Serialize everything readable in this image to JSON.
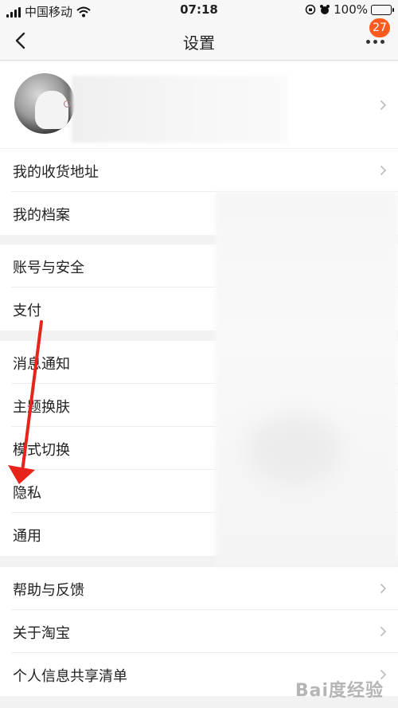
{
  "status_bar": {
    "carrier": "中国移动",
    "time": "07:18",
    "battery": "100%"
  },
  "nav": {
    "title": "设置",
    "notification_count": "27"
  },
  "sections": [
    {
      "items": [
        {
          "label": "我的收货地址"
        },
        {
          "label": "我的档案"
        }
      ]
    },
    {
      "items": [
        {
          "label": "账号与安全"
        },
        {
          "label": "支付"
        }
      ]
    },
    {
      "items": [
        {
          "label": "消息通知"
        },
        {
          "label": "主题换肤"
        },
        {
          "label": "模式切换"
        },
        {
          "label": "隐私"
        },
        {
          "label": "通用"
        }
      ]
    },
    {
      "items": [
        {
          "label": "帮助与反馈"
        },
        {
          "label": "关于淘宝"
        },
        {
          "label": "个人信息共享清单"
        }
      ]
    }
  ],
  "annotation": {
    "color": "#e8231a"
  },
  "watermark": "Bai度经验",
  "colors": {
    "badge": "#ff5a1f",
    "battery": "#3fc24a"
  }
}
